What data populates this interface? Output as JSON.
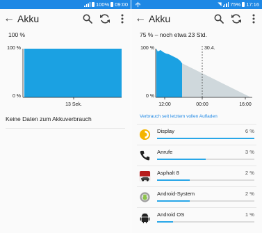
{
  "colors": {
    "statusbar": "#1e88e5",
    "accent": "#29a7e8",
    "link": "#1e88e5",
    "chart_fill": "#1ba1e2",
    "projection": "#cfd8dc"
  },
  "left": {
    "status": {
      "battery": "100%",
      "time": "09:00"
    },
    "appbar": {
      "title": "Akku",
      "back_icon": "arrow-back-icon",
      "search_icon": "search-icon",
      "refresh_icon": "refresh-icon",
      "menu_icon": "more-vert-icon"
    },
    "summary": "100 %",
    "chart": {
      "y_top_label": "100 %",
      "y_bottom_label": "0 %",
      "x_label": "13 Sek."
    },
    "no_data": "Keine Daten zum Akkuverbrauch"
  },
  "right": {
    "status": {
      "battery": "75%",
      "time": "17:16"
    },
    "appbar": {
      "title": "Akku",
      "back_icon": "arrow-back-icon",
      "search_icon": "search-icon",
      "refresh_icon": "refresh-icon",
      "menu_icon": "more-vert-icon"
    },
    "summary": "75 % – noch etwa 23 Std.",
    "chart": {
      "y_top_label": "100 %",
      "y_bottom_label": "0 %",
      "date_marker": "30.4.",
      "x_labels": [
        "12:00",
        "00:00",
        "16:00"
      ]
    },
    "section_link": "Verbrauch seit letztem vollen Aufladen",
    "apps": [
      {
        "name": "Display",
        "pct": "6 %",
        "value": 6,
        "icon": "display-icon"
      },
      {
        "name": "Anrufe",
        "pct": "3 %",
        "value": 3,
        "icon": "phone-icon"
      },
      {
        "name": "Asphalt 8",
        "pct": "2 %",
        "value": 2,
        "icon": "asphalt-game-icon"
      },
      {
        "name": "Android-System",
        "pct": "2 %",
        "value": 2,
        "icon": "android-system-icon"
      },
      {
        "name": "Android OS",
        "pct": "1 %",
        "value": 1,
        "icon": "android-icon"
      }
    ]
  },
  "chart_data": [
    {
      "type": "area",
      "title": "",
      "x": [
        0,
        13
      ],
      "y": [
        100,
        100
      ],
      "ylim": [
        0,
        100
      ],
      "x_tick_labels": [
        "13 Sek."
      ],
      "y_tick_labels": [
        "100 %",
        "0 %"
      ],
      "grid": false
    },
    {
      "type": "area",
      "title": "",
      "series": [
        {
          "name": "",
          "kind": "measured",
          "x": [
            "10:00",
            "12:00",
            "14:00",
            "16:00",
            "17:16"
          ],
          "y": [
            100,
            95,
            90,
            87,
            75
          ]
        },
        {
          "name": "",
          "kind": "projection",
          "x": [
            "17:16",
            "16:00"
          ],
          "y": [
            75,
            0
          ]
        }
      ],
      "ylim": [
        0,
        100
      ],
      "x_tick_labels": [
        "12:00",
        "00:00",
        "16:00"
      ],
      "y_tick_labels": [
        "100 %",
        "0 %"
      ],
      "annotations": [
        "30.4."
      ],
      "grid": false
    }
  ]
}
